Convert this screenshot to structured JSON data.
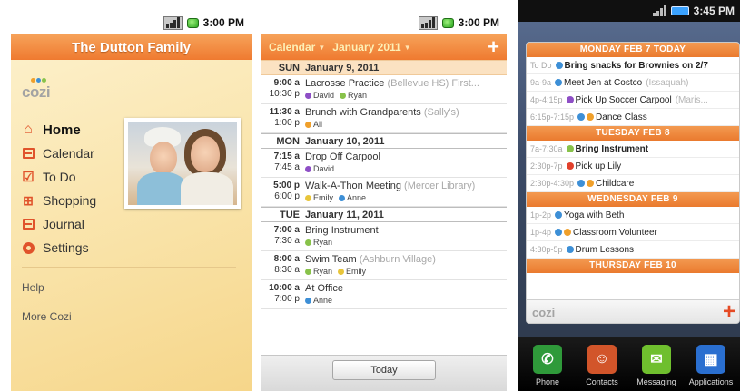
{
  "colors": {
    "accent_orange": "#ef7a30",
    "purple": "#8e4fc6",
    "green": "#88c24a",
    "orange": "#f0a02b",
    "blue": "#3d8fd6",
    "yellow": "#e8c53a",
    "red": "#e2402c"
  },
  "screen1": {
    "status": {
      "time": "3:00 PM"
    },
    "title": "The Dutton Family",
    "logo": "cozi",
    "menu": [
      {
        "label": "Home",
        "icon": "home-icon"
      },
      {
        "label": "Calendar",
        "icon": "calendar-icon"
      },
      {
        "label": "To Do",
        "icon": "checklist-icon"
      },
      {
        "label": "Shopping",
        "icon": "shopping-cart-icon"
      },
      {
        "label": "Journal",
        "icon": "journal-icon"
      },
      {
        "label": "Settings",
        "icon": "settings-icon"
      }
    ],
    "links": {
      "help": "Help",
      "more": "More Cozi"
    }
  },
  "screen2": {
    "status": {
      "time": "3:00 PM"
    },
    "header": {
      "view": "Calendar",
      "month": "January 2011",
      "add": "+"
    },
    "days": [
      {
        "dow": "SUN",
        "date": "January 9, 2011",
        "events": [
          {
            "start": "9:00 a",
            "end": "10:30 p",
            "title": "Lacrosse Practice",
            "location": "(Bellevue HS) First...",
            "who": [
              {
                "name": "David",
                "color": "purple"
              },
              {
                "name": "Ryan",
                "color": "green"
              }
            ]
          },
          {
            "start": "11:30 a",
            "end": "1:00 p",
            "title": "Brunch with Grandparents",
            "location": "(Sally's)",
            "who": [
              {
                "name": "All",
                "color": "orange"
              }
            ]
          }
        ]
      },
      {
        "dow": "MON",
        "date": "January 10, 2011",
        "events": [
          {
            "start": "7:15 a",
            "end": "7:45 a",
            "title": "Drop Off Carpool",
            "location": "",
            "who": [
              {
                "name": "David",
                "color": "purple"
              }
            ]
          },
          {
            "start": "5:00 p",
            "end": "6:00 p",
            "title": "Walk-A-Thon Meeting",
            "location": "(Mercer Library)",
            "who": [
              {
                "name": "Emily",
                "color": "yellow"
              },
              {
                "name": "Anne",
                "color": "blue"
              }
            ]
          }
        ]
      },
      {
        "dow": "TUE",
        "date": "January 11, 2011",
        "events": [
          {
            "start": "7:00 a",
            "end": "7:30 a",
            "title": "Bring Instrument",
            "location": "",
            "who": [
              {
                "name": "Ryan",
                "color": "green"
              }
            ]
          },
          {
            "start": "8:00 a",
            "end": "8:30 a",
            "title": "Swim Team",
            "location": "(Ashburn Village)",
            "who": [
              {
                "name": "Ryan",
                "color": "green"
              },
              {
                "name": "Emily",
                "color": "yellow"
              }
            ]
          },
          {
            "start": "10:00 a",
            "end": "7:00 p",
            "title": "At Office",
            "location": "",
            "who": [
              {
                "name": "Anne",
                "color": "blue"
              }
            ]
          }
        ]
      }
    ],
    "today_button": "Today"
  },
  "screen3": {
    "status": {
      "time": "3:45 PM"
    },
    "days": [
      {
        "label": "MONDAY FEB 7 TODAY",
        "events": [
          {
            "time": "To Do",
            "title": "Bring snacks for Brownies on 2/7",
            "bold": true,
            "dots": [
              "blue"
            ],
            "location": ""
          },
          {
            "time": "9a-9a",
            "title": "Meet Jen at Costco",
            "bold": false,
            "dots": [
              "blue"
            ],
            "location": "(Issaquah)"
          },
          {
            "time": "4p-4:15p",
            "title": "Pick Up Soccer Carpool",
            "bold": false,
            "dots": [
              "purple"
            ],
            "location": "(Maris..."
          },
          {
            "time": "6:15p-7:15p",
            "title": "Dance Class",
            "bold": false,
            "dots": [
              "blue",
              "orange"
            ],
            "location": ""
          }
        ]
      },
      {
        "label": "TUESDAY FEB 8",
        "events": [
          {
            "time": "7a-7:30a",
            "title": "Bring Instrument",
            "bold": true,
            "dots": [
              "green"
            ],
            "location": ""
          },
          {
            "time": "2:30p-7p",
            "title": "Pick up Lily",
            "bold": false,
            "dots": [
              "red"
            ],
            "location": ""
          },
          {
            "time": "2:30p-4:30p",
            "title": "Childcare",
            "bold": false,
            "dots": [
              "blue",
              "orange"
            ],
            "location": ""
          }
        ]
      },
      {
        "label": "WEDNESDAY FEB 9",
        "events": [
          {
            "time": "1p-2p",
            "title": "Yoga with Beth",
            "bold": false,
            "dots": [
              "blue"
            ],
            "location": ""
          },
          {
            "time": "1p-4p",
            "title": "Classroom Volunteer",
            "bold": false,
            "dots": [
              "blue",
              "orange"
            ],
            "location": ""
          },
          {
            "time": "4:30p-5p",
            "title": "Drum Lessons",
            "bold": false,
            "dots": [
              "blue"
            ],
            "location": ""
          }
        ]
      },
      {
        "label": "THURSDAY FEB 10",
        "events": []
      }
    ],
    "logo": "cozi",
    "add": "+",
    "dock": [
      {
        "label": "Phone",
        "icon": "phone-icon",
        "color": "#2f9a3a",
        "glyph": "✆"
      },
      {
        "label": "Contacts",
        "icon": "contacts-icon",
        "color": "#d2552a",
        "glyph": "☺"
      },
      {
        "label": "Messaging",
        "icon": "messaging-icon",
        "color": "#6fbf2e",
        "glyph": "✉"
      },
      {
        "label": "Applications",
        "icon": "applications-icon",
        "color": "#2a6fd0",
        "glyph": "▦"
      }
    ]
  }
}
